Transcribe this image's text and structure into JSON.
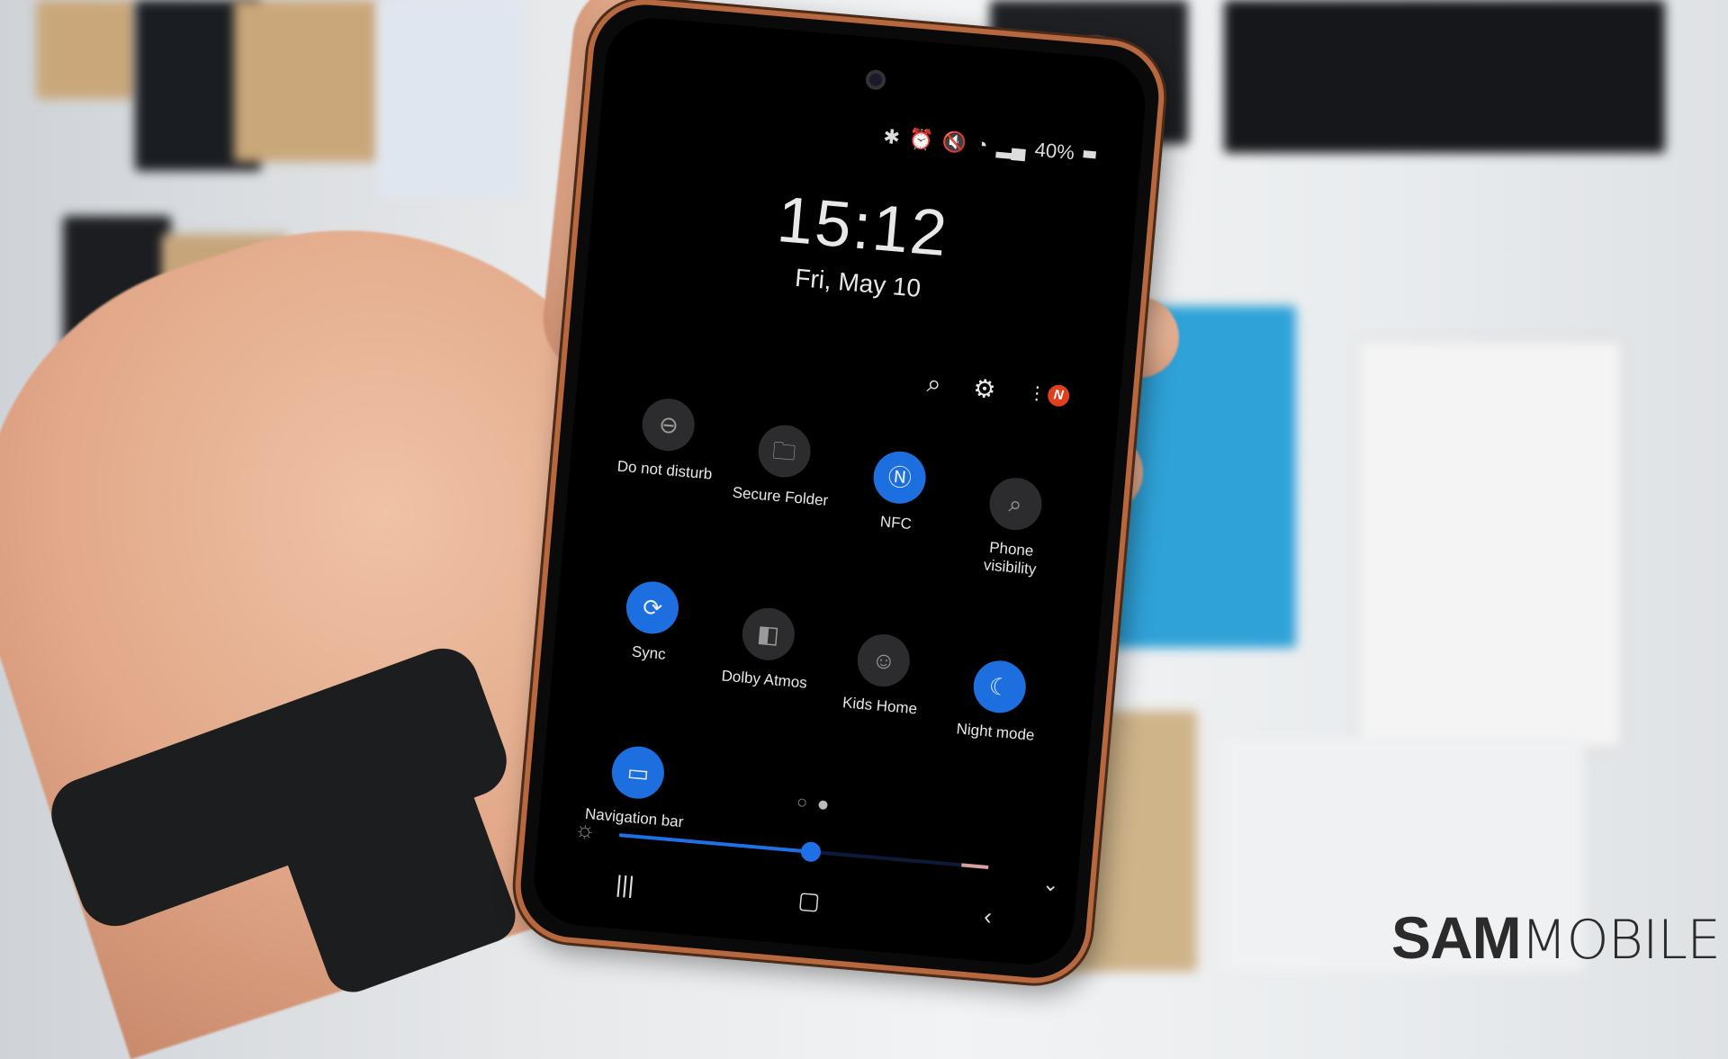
{
  "status_bar": {
    "icons": [
      "bluetooth-icon",
      "alarm-icon",
      "mute-icon",
      "wifi-icon",
      "signal-icon",
      "battery-icon"
    ],
    "battery": "40%"
  },
  "lock": {
    "time": "15:12",
    "date": "Fri, May 10"
  },
  "panel_actions": {
    "search": "search-icon",
    "settings": "gear-icon",
    "more": "more-icon",
    "notification_badge": "N"
  },
  "tiles": [
    {
      "label": "Do not disturb",
      "icon": "minus-circle-icon",
      "glyph": "⊖",
      "on": false
    },
    {
      "label": "Secure Folder",
      "icon": "secure-folder-icon",
      "glyph": "🗀",
      "on": false
    },
    {
      "label": "NFC",
      "icon": "nfc-icon",
      "glyph": "Ⓝ",
      "on": true
    },
    {
      "label": "Phone visibility",
      "icon": "phone-visibility-icon",
      "glyph": "⌕",
      "on": false
    },
    {
      "label": "Sync",
      "icon": "sync-icon",
      "glyph": "⟳",
      "on": true
    },
    {
      "label": "Dolby Atmos",
      "icon": "dolby-icon",
      "glyph": "◧",
      "on": false
    },
    {
      "label": "Kids Home",
      "icon": "kids-home-icon",
      "glyph": "☺",
      "on": false
    },
    {
      "label": "Night mode",
      "icon": "moon-icon",
      "glyph": "☾",
      "on": true
    },
    {
      "label": "Navigation bar",
      "icon": "navigation-bar-icon",
      "glyph": "▭",
      "on": true
    }
  ],
  "pager": {
    "pages": 2,
    "current": 2
  },
  "brightness": {
    "level_percent": 52
  },
  "navbar": {
    "recents": "|||",
    "home": "▢",
    "back": "‹"
  },
  "colors": {
    "accent": "#1d6fe0",
    "badge": "#e0401f",
    "frame": "#b8683e"
  },
  "watermark": {
    "bold": "SAM",
    "light": "MOBILE"
  }
}
